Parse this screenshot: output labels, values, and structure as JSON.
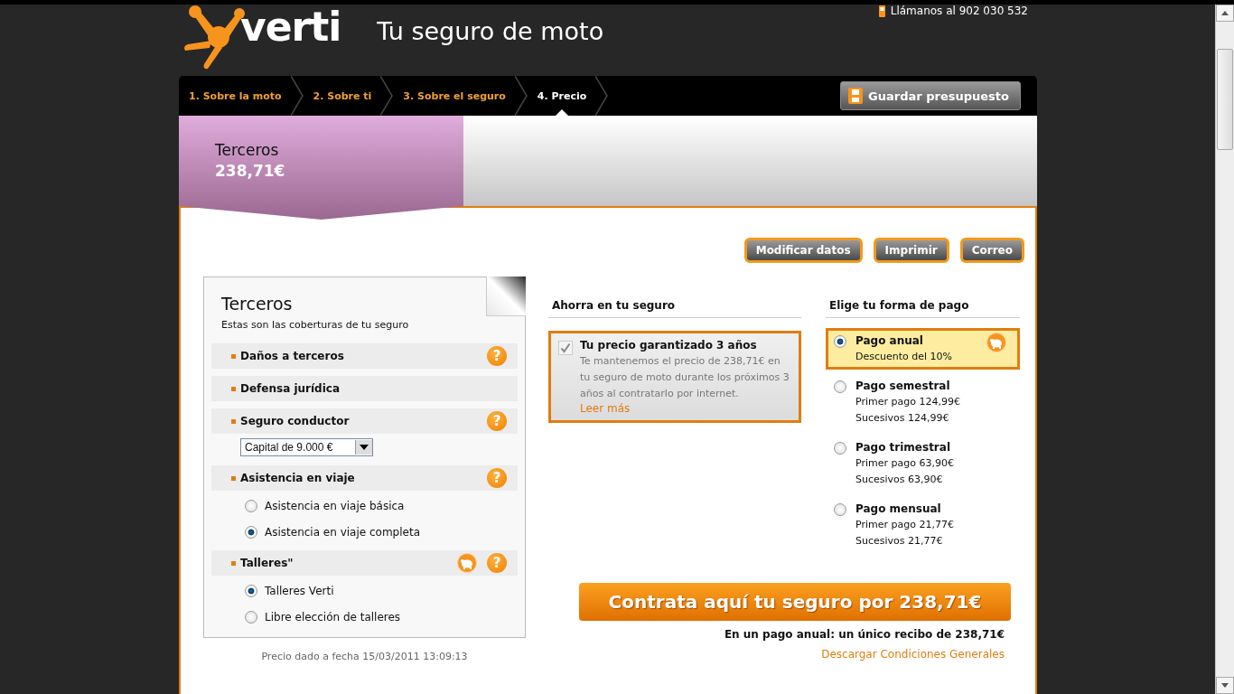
{
  "header": {
    "logo_text": "verti",
    "title": "Tu seguro de moto",
    "phone": "Llámanos al 902 030 532"
  },
  "steps": [
    {
      "label": "1. Sobre la moto",
      "selected": false
    },
    {
      "label": "2. Sobre ti",
      "selected": false
    },
    {
      "label": "3. Sobre el seguro",
      "selected": false
    },
    {
      "label": "4. Precio",
      "selected": true
    }
  ],
  "save_button": "Guardar presupuesto",
  "summary": {
    "product": "Terceros",
    "price": "238,71€"
  },
  "actions": [
    "Modificar datos",
    "Imprimir",
    "Correo"
  ],
  "coverage": {
    "title": "Terceros",
    "subtitle": "Estas son las coberturas de tu seguro",
    "items": [
      {
        "label": "Daños a terceros",
        "help": "?",
        "savings": false
      },
      {
        "label": "Defensa jurídica",
        "savings": false
      },
      {
        "label": "Seguro conductor",
        "help": "?",
        "savings": false,
        "select": "Capital de 9.000 €"
      },
      {
        "label": "Asistencia en viaje",
        "help": "?",
        "savings": false,
        "options": [
          {
            "label": "Asistencia en viaje básica",
            "selected": false
          },
          {
            "label": "Asistencia en viaje completa",
            "selected": true
          }
        ]
      },
      {
        "label": "Talleres\"",
        "help": "?",
        "savings": true,
        "options": [
          {
            "label": "Talleres Verti",
            "selected": true
          },
          {
            "label": "Libre elección de talleres",
            "selected": false
          }
        ]
      }
    ],
    "footer": "Precio dado a fecha 15/03/2011 13:09:13"
  },
  "savings": {
    "heading": "Ahorra en tu seguro",
    "offer": {
      "title": "Tu precio garantizado 3 años",
      "checked": true,
      "text": "Te mantenemos el precio de 238,71€ en tu seguro de moto durante los próximos 3 años al contratarlo por internet.",
      "link": "Leer más"
    }
  },
  "payment": {
    "heading": "Elige tu forma de pago",
    "options": [
      {
        "title": "Pago anual",
        "lines": [
          "Descuento del 10%"
        ],
        "selected": true,
        "savings": true
      },
      {
        "title": "Pago semestral",
        "lines": [
          "Primer pago 124,99€",
          "Sucesivos 124,99€"
        ],
        "selected": false,
        "savings": false
      },
      {
        "title": "Pago trimestral",
        "lines": [
          "Primer pago 63,90€",
          "Sucesivos 63,90€"
        ],
        "selected": false,
        "savings": false
      },
      {
        "title": "Pago mensual",
        "lines": [
          "Primer pago 21,77€",
          "Sucesivos 21,77€"
        ],
        "selected": false,
        "savings": false
      }
    ]
  },
  "cta": "Contrata aquí tu seguro por 238,71€",
  "cta_note": "En un pago anual: un único recibo de 238,71€",
  "conditions_link": "Descargar Condiciones Generales"
}
